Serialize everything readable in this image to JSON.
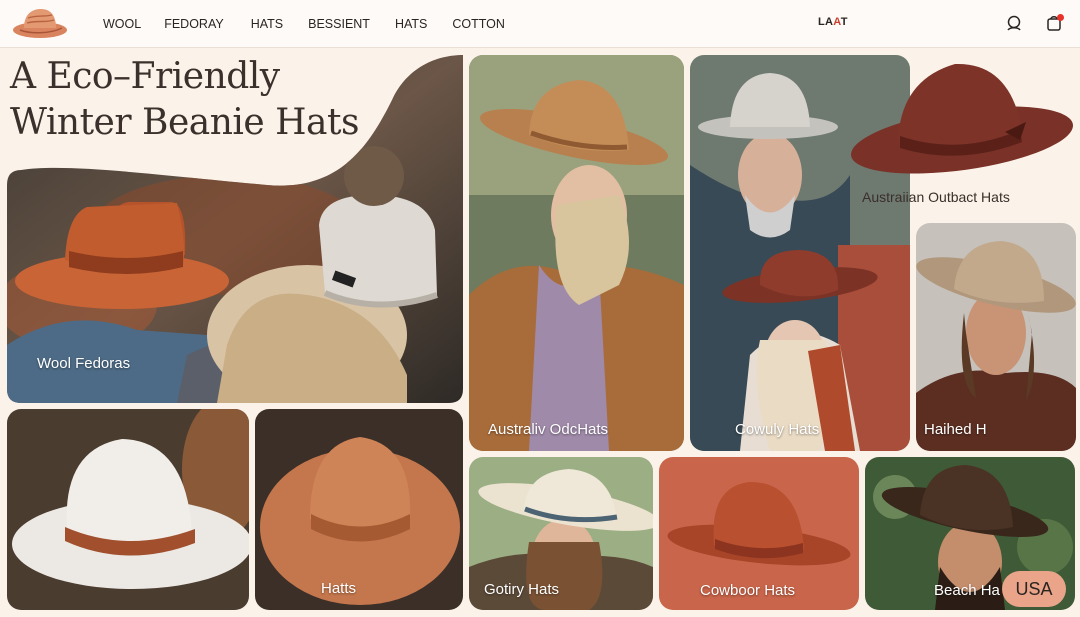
{
  "header": {
    "nav": [
      "WOOL",
      "FEDORAY",
      "HATS",
      "BESSIENT",
      "HATS",
      "COTTON"
    ],
    "brand_prefix": "LA",
    "brand_highlight": "A",
    "brand_suffix": "T"
  },
  "hero": {
    "title_line1": "A Eco–Friendly",
    "title_line2": "Winter Beanie Hats"
  },
  "cards": {
    "wool_fedoras": "Wool Fedoras",
    "australia": "Australiv OdcHats",
    "cowboy": "Cowuly Hats",
    "outback": "Austraiian Outbact Hats",
    "haihed": "Haihed H",
    "hatts": "Hatts",
    "cotton_hats": "Gotiry Hats",
    "cowboor": "Cowboor Hats",
    "beach": "Beach Ha"
  },
  "badge": {
    "label": "USA"
  },
  "colors": {
    "background": "#fbf3ea",
    "accent_rust": "#c9654a",
    "badge": "#e9a48a",
    "notification": "#e8322a"
  }
}
